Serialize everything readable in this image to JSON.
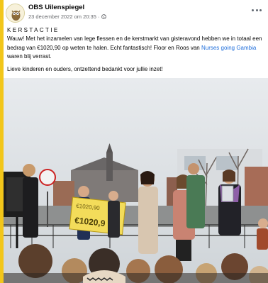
{
  "post": {
    "page_name": "OBS Uilenspiegel",
    "timestamp": "23 december 2022 om 20:35",
    "separator": "·",
    "heading": "KERSTACTIE",
    "body_part1": "Wauw! Met het inzamelen van lege flessen en de kerstmarkt van gisteravond hebben we in totaal een bedrag van €1020,90 op weten te halen. Echt fantastisch! Floor en Roos van ",
    "link_text": "Nurses going Gambia",
    "body_part2": " waren blij verrast.",
    "body_line2": "Lieve kinderen en ouders, ontzettend bedankt voor jullie inzet!",
    "photo": {
      "cheque_line1": "€1020,90",
      "cheque_amount": "€1020,9"
    }
  },
  "colors": {
    "page_background": "#f2c61a",
    "link": "#216fdb",
    "meta": "#65676b"
  },
  "icons": {
    "privacy": "globe-icon",
    "menu": "more-options-icon"
  }
}
